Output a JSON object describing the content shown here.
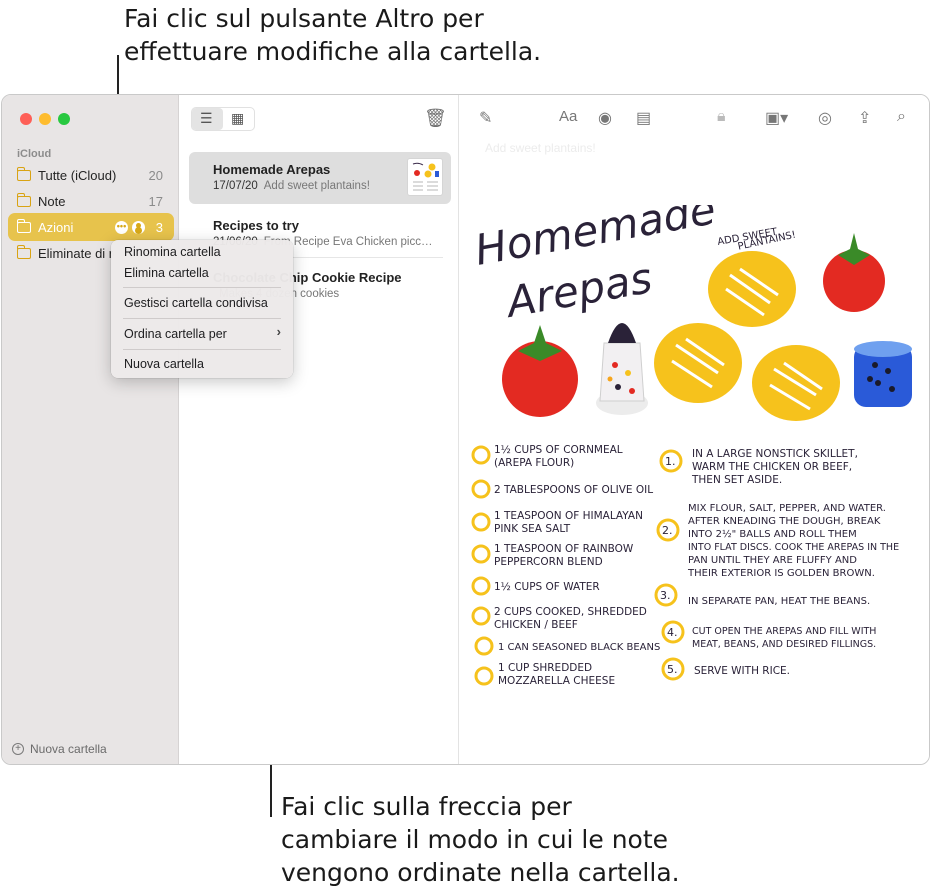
{
  "callouts": {
    "top_line1": "Fai clic sul pulsante Altro per",
    "top_line2": "effettuare modifiche alla cartella.",
    "bottom_line1": "Fai clic sulla freccia per",
    "bottom_line2": "cambiare il modo in cui le note",
    "bottom_line3": "vengono ordinate nella cartella."
  },
  "sidebar": {
    "section": "iCloud",
    "folders": [
      {
        "label": "Tutte (iCloud)",
        "count": "20"
      },
      {
        "label": "Note",
        "count": "17"
      },
      {
        "label": "Azioni",
        "count": "3"
      },
      {
        "label": "Eliminate di recente",
        "count": ""
      }
    ],
    "new_folder": "Nuova cartella"
  },
  "context_menu": {
    "items": [
      "Rinomina cartella",
      "Elimina cartella",
      "Gestisci cartella condivisa",
      "Ordina cartella per",
      "Nuova cartella"
    ]
  },
  "notes": [
    {
      "title": "Homemade Arepas",
      "date": "17/07/20",
      "preview": "Add sweet plantains!"
    },
    {
      "title": "Recipes to try",
      "date": "21/06/20",
      "preview": "From Recipe Eva Chicken picc…"
    },
    {
      "title": "Chocolate Chip Cookie Recipe",
      "date": "",
      "preview": "Makes 4 dozen cookies"
    }
  ],
  "editor": {
    "ghost": "Add sweet plantains!",
    "toolbar_icons": [
      "compose-icon",
      "format-text-icon",
      "checklist-icon",
      "table-icon",
      "lock-icon",
      "media-icon",
      "collaborate-icon",
      "share-icon",
      "search-icon"
    ],
    "drawing": {
      "title1": "Homemade",
      "title2": "Arepas",
      "note1": "ADD SWEET",
      "note2": "PLANTAINS!",
      "ingredients": [
        "1½ CUPS OF CORNMEAL",
        "(AREPA FLOUR)",
        "2 TABLESPOONS OF OLIVE OIL",
        "1 TEASPOON OF HIMALAYAN",
        "PINK SEA SALT",
        "1 TEASPOON OF RAINBOW",
        "PEPPERCORN BLEND",
        "1½ CUPS OF WATER",
        "2 CUPS COOKED, SHREDDED",
        "CHICKEN / BEEF",
        "1 CAN SEASONED BLACK BEANS",
        "1 CUP SHREDDED",
        "MOZZARELLA CHEESE"
      ],
      "steps": [
        "IN A LARGE NONSTICK SKILLET,",
        "WARM THE CHICKEN OR BEEF,",
        "THEN SET ASIDE.",
        "MIX FLOUR, SALT, PEPPER, AND WATER.",
        "AFTER KNEADING THE DOUGH, BREAK",
        "INTO 2½\" BALLS AND ROLL THEM",
        "INTO FLAT DISCS. COOK THE AREPAS IN THE",
        "PAN UNTIL THEY ARE FLUFFY AND",
        "THEIR EXTERIOR IS GOLDEN BROWN.",
        "IN SEPARATE PAN, HEAT THE BEANS.",
        "CUT OPEN THE AREPAS AND FILL WITH",
        "MEAT, BEANS, AND DESIRED FILLINGS.",
        "SERVE WITH RICE."
      ],
      "step_numbers": [
        "1.",
        "2.",
        "3.",
        "4.",
        "5."
      ]
    }
  },
  "colors": {
    "accent": "#e7c34c",
    "ink": "#2a2238",
    "arepa": "#f6c21c",
    "tomato": "#e32a22"
  }
}
